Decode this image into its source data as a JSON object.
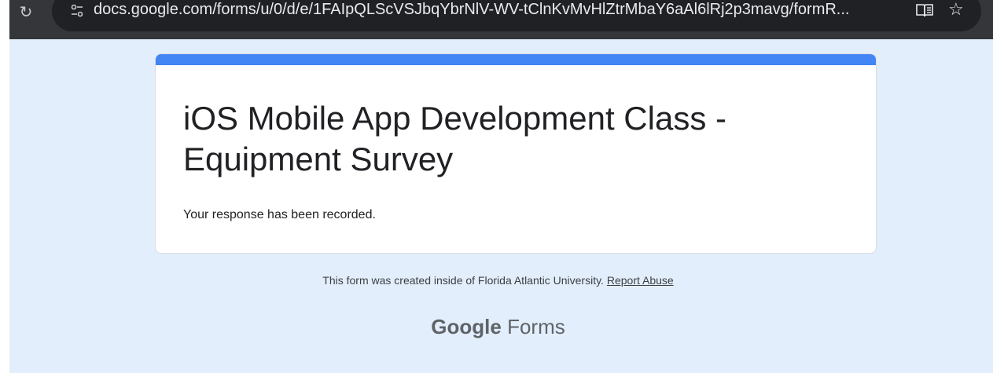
{
  "browser": {
    "url": "docs.google.com/forms/u/0/d/e/1FAIpQLScVSJbqYbrNlV-WV-tClnKvMvHlZtrMbaY6aAl6lRj2p3mavg/formR...",
    "icons": [
      "reload-icon",
      "tune-icon",
      "reader-mode-icon",
      "bookmark-star-icon"
    ]
  },
  "form": {
    "title": "iOS Mobile App Development Class - Equipment Survey",
    "confirmation": "Your response has been recorded.",
    "accent_color": "#4285f4"
  },
  "footer": {
    "notice": "This form was created inside of Florida Atlantic University.",
    "report_link": "Report Abuse"
  },
  "brand": {
    "google": "Google",
    "forms": "Forms"
  }
}
